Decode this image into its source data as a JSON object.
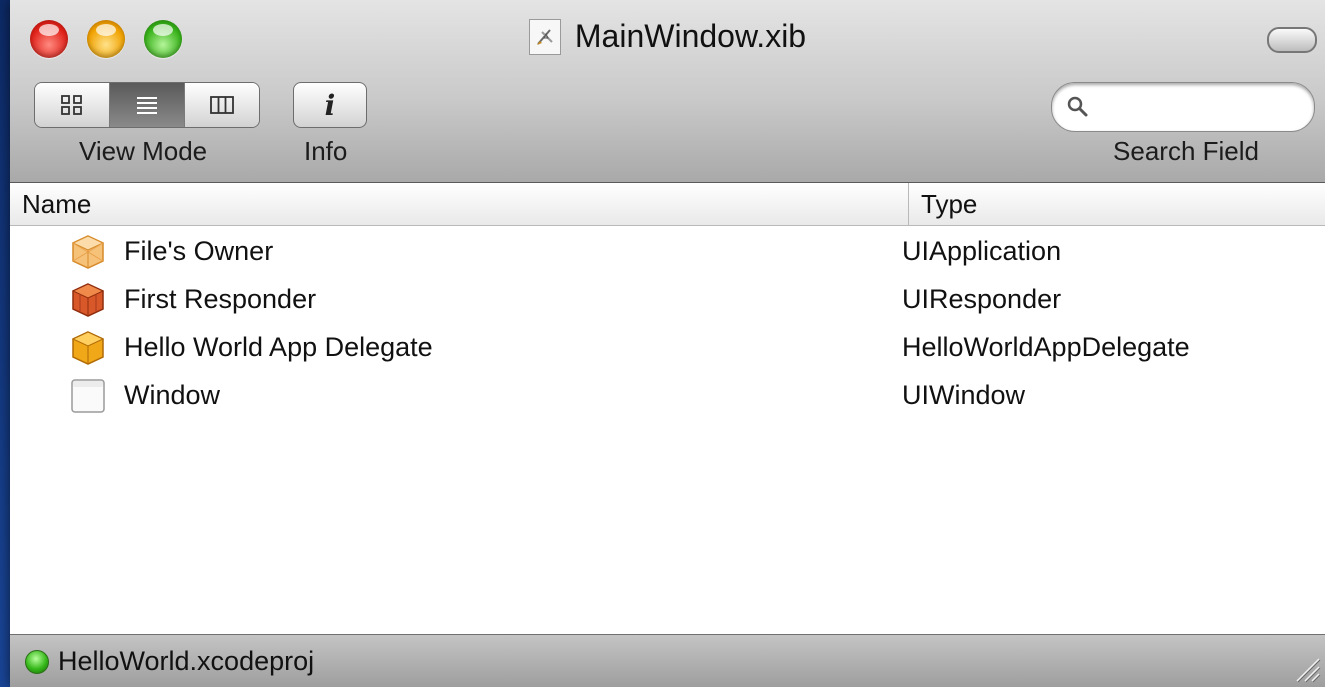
{
  "window": {
    "title": "MainWindow.xib",
    "title_icon": "xib-document-icon"
  },
  "toolbar": {
    "view_mode_label": "View Mode",
    "view_mode_selected": "list",
    "view_mode_options": [
      "icon",
      "list",
      "column"
    ],
    "info_label": "Info",
    "info_glyph": "i",
    "search_label": "Search Field",
    "search_value": "",
    "search_placeholder": ""
  },
  "table": {
    "columns": [
      "Name",
      "Type"
    ],
    "rows": [
      {
        "name": "File's Owner",
        "type": "UIApplication",
        "icon": "placeholder-cube-icon"
      },
      {
        "name": "First Responder",
        "type": "UIResponder",
        "icon": "first-responder-cube-icon"
      },
      {
        "name": "Hello World App Delegate",
        "type": "HelloWorldAppDelegate",
        "icon": "object-cube-icon"
      },
      {
        "name": "Window",
        "type": "UIWindow",
        "icon": "window-icon"
      }
    ]
  },
  "status": {
    "text": "HelloWorld.xcodeproj",
    "indicator_color": "#36b81a"
  },
  "colors": {
    "desktop": "#1e4fa8",
    "close": "#e0221a",
    "minimize": "#f0a100",
    "zoom": "#38b21a"
  }
}
